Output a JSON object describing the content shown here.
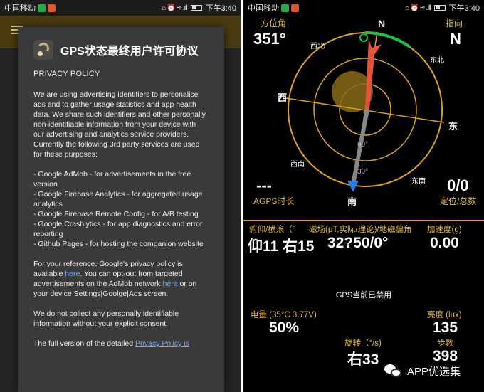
{
  "status_left": {
    "carrier": "中国移动",
    "time": "下午3:40",
    "icons": "⌂ ⏰ ≋ .ıll"
  },
  "status_right": {
    "carrier": "中国移动",
    "time": "下午3:40",
    "icons": "⌂ ⏰ ≋ .ıll"
  },
  "dialog": {
    "title": "GPS状态最终用户许可协议",
    "policy_heading": "PRIVACY POLICY",
    "para1": "We are using advertising identifiers to personalise ads and to gather usage statistics and app health data. We share such identifiers and other personally non-identifiable information from your device with our advertising and analytics service providers. Currently the following 3rd party services are used for these purposes:",
    "list": [
      "- Google AdMob - for advertisements in the free version",
      "- Google Firebase Analytics - for aggregated usage analytics",
      "- Google Firebase Remote Config - for A/B testing",
      "- Google Crashlytics - for app diagnostics and error reporting",
      "- Github Pages - for hosting the companion website"
    ],
    "para2_a": "For your reference, Google's privacy policy is available ",
    "para2_link1": "here",
    "para2_b": ". You can opt-out from targeted advertisements on the AdMob network ",
    "para2_link2": "here",
    "para2_c": " or on your device Settings|Goolge|Ads screen.",
    "para3": "We do not collect any personally identifiable information without your explicit consent.",
    "para4_a": "The full version of the detailed ",
    "para4_link": "Privacy Policy is"
  },
  "compass": {
    "azimuth_label": "方位角",
    "azimuth_value": "351°",
    "heading_label": "指向",
    "heading_value": "N",
    "dir_n": "N",
    "dir_east_en": "东",
    "dir_west": "西",
    "dir_south": "南",
    "dir_northwest": "西北",
    "dir_northeast": "东北",
    "dir_southwest": "西南",
    "dir_southeast": "东南",
    "ring_60": "60°",
    "ring_30": "30°",
    "agps_value": "---",
    "agps_label": "AGPS时长",
    "fix_value": "0/0",
    "fix_label": "定位/总数"
  },
  "sensors": {
    "tilt_label": "俯仰/横滚（°",
    "mag_label": "磁场(μT,实际/理论)/地磁偏角",
    "accel_label": "加速度(g)",
    "tilt_value": "仰11 右15",
    "mag_value": "32?50/0°",
    "accel_value": "0.00",
    "gps_state": "GPS当前已禁用",
    "battery_label": "电量 (35°C 3.77V)",
    "battery_value": "50%",
    "brightness_label": "亮度 (lux)",
    "brightness_value": "135",
    "rotation_label": "旋转（°/s)",
    "rotation_value": "右33",
    "steps_label": "步数",
    "steps_value": "398"
  },
  "watermark": {
    "text": "APP优选集"
  },
  "colors": {
    "accent": "#d8a22a",
    "green": "#22c04a",
    "needle_red": "#e5533a",
    "needle_blue": "#2a7be4"
  }
}
